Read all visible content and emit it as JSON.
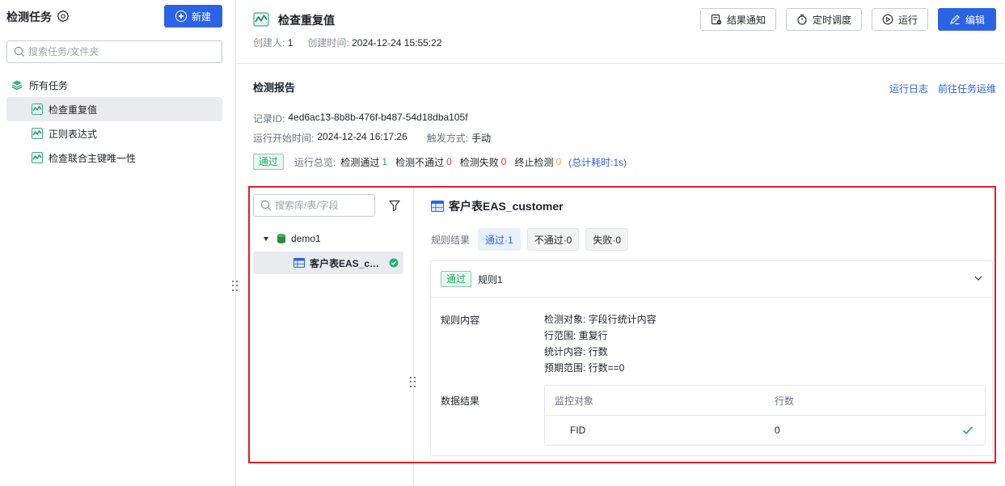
{
  "sidebar": {
    "title": "检测任务",
    "new_button": "新建",
    "search_placeholder": "搜索任务/文件夹",
    "root_label": "所有任务",
    "items": [
      {
        "label": "检查重复值",
        "active": true
      },
      {
        "label": "正则表达式",
        "active": false
      },
      {
        "label": "检查联合主键唯一性",
        "active": false
      }
    ]
  },
  "header": {
    "task_title": "检查重复值",
    "creator_label": "创建人:",
    "creator_value": "1",
    "created_label": "创建时间:",
    "created_value": "2024-12-24 15:55:22",
    "buttons": {
      "notify": "结果通知",
      "schedule": "定时调度",
      "run": "运行",
      "edit": "编辑"
    }
  },
  "report": {
    "title": "检测报告",
    "links": {
      "log": "运行日志",
      "ops": "前往任务运维"
    },
    "record_label": "记录ID:",
    "record_id": "4ed6ac13-8b8b-476f-b487-54d18dba105f",
    "start_label": "运行开始时间:",
    "start_value": "2024-12-24 16:17:26",
    "trigger_label": "触发方式:",
    "trigger_value": "手动",
    "status_tag": "通过",
    "overview_label": "运行总览:",
    "pass_label": "检测通过",
    "pass_count": "1",
    "fail_label": "检测不通过",
    "fail_count": "0",
    "error_label": "检测失败",
    "error_count": "0",
    "stop_label": "终止检测",
    "stop_count": "0",
    "total_time": "(总计耗时:1s)"
  },
  "object_tree": {
    "search_placeholder": "搜索库/表/字段",
    "db_name": "demo1",
    "table_name": "客户表EAS_customer"
  },
  "detail": {
    "table_title": "客户表EAS_customer",
    "filter_label": "规则结果",
    "filters": {
      "pass": "通过·1",
      "fail": "不通过·0",
      "error": "失败·0"
    },
    "rule": {
      "status_tag": "通过",
      "name": "规则1",
      "content_label": "规则内容",
      "content_lines": [
        "检测对象: 字段行统计内容",
        "行范围: 重复行",
        "统计内容: 行数",
        "预期范围: 行数==0"
      ],
      "result_label": "数据结果",
      "table": {
        "headers": [
          "监控对象",
          "行数"
        ],
        "rows": [
          {
            "object": "FID",
            "count": "0"
          }
        ]
      }
    }
  },
  "colors": {
    "primary": "#2a63e4",
    "pass": "#1ea85a",
    "fail": "#e53935",
    "warn": "#f5a623",
    "highlight_frame": "#e02020"
  }
}
